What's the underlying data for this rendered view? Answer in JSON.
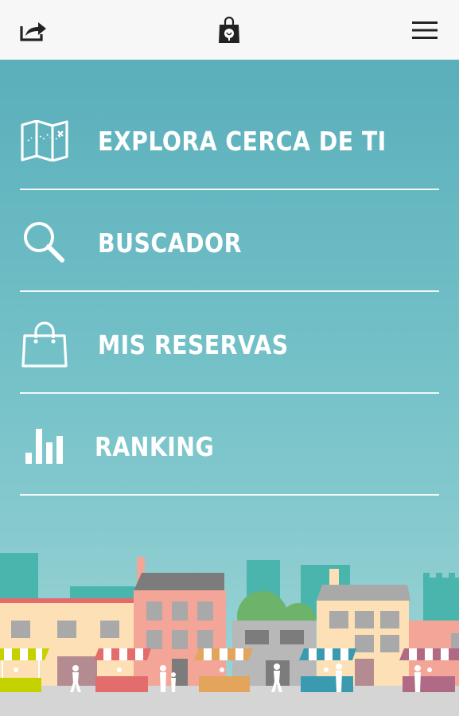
{
  "topbar": {
    "share_icon": "share-icon",
    "logo_icon": "shopping-bag-logo-icon",
    "menu_icon": "hamburger-menu-icon"
  },
  "menu": {
    "items": [
      {
        "label": "EXPLORA CERCA DE TI",
        "icon": "map-icon"
      },
      {
        "label": "BUSCADOR",
        "icon": "search-icon"
      },
      {
        "label": "MIS RESERVAS",
        "icon": "shopping-bag-icon"
      },
      {
        "label": "RANKING",
        "icon": "bar-chart-icon"
      }
    ]
  },
  "colors": {
    "background_top": "#5aafbb",
    "background_bottom": "#9fd5d6",
    "text": "#ffffff",
    "topbar": "#f7f7f7"
  }
}
